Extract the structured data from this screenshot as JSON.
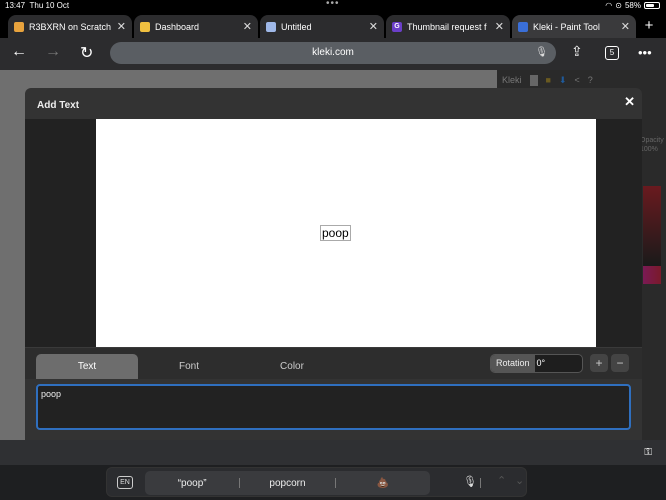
{
  "status_bar": {
    "time": "13:47",
    "date": "Thu 10 Oct",
    "battery_percent": "58%",
    "battery_level": 0.58
  },
  "browser": {
    "tabs": [
      {
        "label": "R3BXRN on Scratch",
        "favicon_color": "#e8a33d",
        "active": false
      },
      {
        "label": "Dashboard",
        "favicon_color": "#f0c040",
        "active": false
      },
      {
        "label": "Untitled",
        "favicon_color": "#9fb8e8",
        "active": false
      },
      {
        "label": "Thumbnail request f",
        "favicon_color": "#6b3fc9",
        "favicon_text": "G",
        "active": false
      },
      {
        "label": "Kleki - Paint Tool",
        "favicon_color": "#3a6fd8",
        "active": true
      }
    ],
    "new_tab_label": "+",
    "url": "kleki.com",
    "tab_count": "5"
  },
  "kleki": {
    "logo": "Kleki",
    "opacity_label": "Opacity",
    "opacity_value": "100%"
  },
  "dialog": {
    "title": "Add Text",
    "close_label": "✕",
    "canvas_text": "poop",
    "tabs": [
      {
        "label": "Text",
        "active": true
      },
      {
        "label": "Font",
        "active": false
      },
      {
        "label": "Color",
        "active": false
      }
    ],
    "rotation_label": "Rotation",
    "rotation_value": "0°",
    "zoom_in_label": "+",
    "zoom_out_label": "−",
    "text_input_value": "poop"
  },
  "keyboard": {
    "language": "EN",
    "suggestions": [
      "“poop”",
      "popcorn",
      "💩"
    ]
  }
}
